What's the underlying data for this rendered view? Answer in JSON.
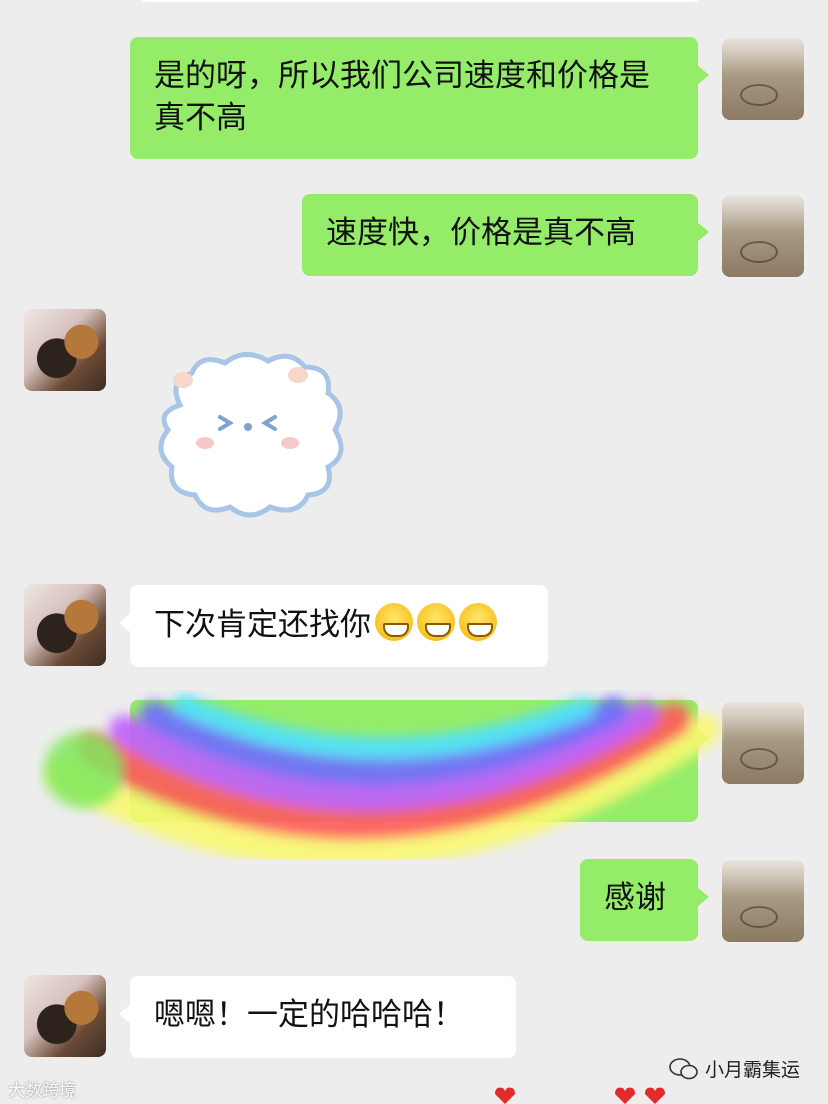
{
  "messages": [
    {
      "side": "right",
      "type": "text",
      "text": "是的呀，所以我们公司速度和价格是真不高"
    },
    {
      "side": "right",
      "type": "text",
      "text": "速度快，价格是真不高"
    },
    {
      "side": "left",
      "type": "sticker",
      "sticker": "fluffy-cloud-bear-sticker"
    },
    {
      "side": "left",
      "type": "text",
      "text": "下次肯定还找你",
      "emojis": [
        "grin-emoji",
        "grin-emoji",
        "grin-emoji"
      ]
    },
    {
      "side": "right",
      "type": "text-obscured",
      "obscured_by": "rainbow-sticker"
    },
    {
      "side": "right",
      "type": "text",
      "text": "感谢"
    },
    {
      "side": "left",
      "type": "text",
      "text": "嗯嗯！一定的哈哈哈！"
    }
  ],
  "watermark": {
    "left": "大数跨境",
    "right": "小月霸集运"
  },
  "colors": {
    "background": "#ededed",
    "bubble_self": "#95ec69",
    "bubble_other": "#ffffff"
  }
}
